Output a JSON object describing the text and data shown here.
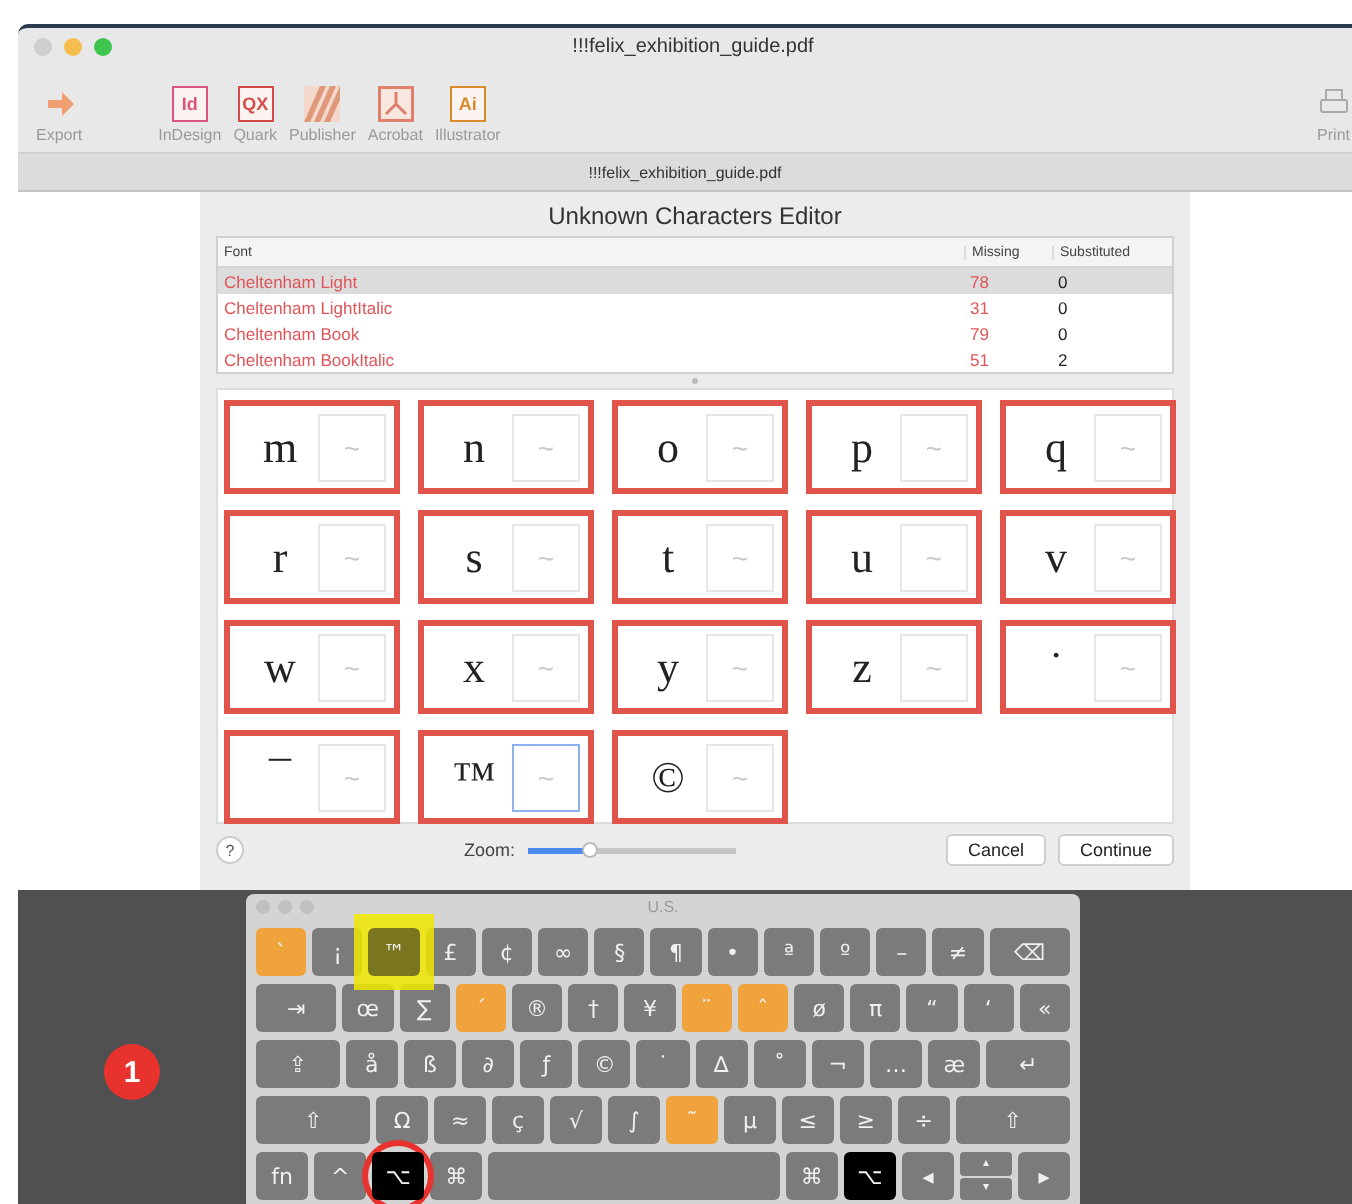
{
  "window": {
    "title": "!!!felix_exhibition_guide.pdf"
  },
  "toolbar": [
    {
      "label": "Export",
      "kind": "export",
      "color": "#f0a070",
      "disabled": true
    },
    {
      "label": "InDesign",
      "kind": "letters",
      "badge": "Id",
      "color": "#d9557f",
      "disabled": true
    },
    {
      "label": "Quark",
      "kind": "letters",
      "badge": "QX",
      "color": "#d64a4a",
      "disabled": true
    },
    {
      "label": "Publisher",
      "kind": "stripes",
      "color": "#e0987a",
      "disabled": true
    },
    {
      "label": "Acrobat",
      "kind": "acrobat",
      "color": "#e07f6b",
      "disabled": true
    },
    {
      "label": "Illustrator",
      "kind": "letters",
      "badge": "Ai",
      "color": "#d98a2a",
      "disabled": true
    }
  ],
  "print": {
    "label": "Print",
    "disabled": true
  },
  "document_tab": {
    "title": "!!!felix_exhibition_guide.pdf"
  },
  "dialog": {
    "title": "Unknown Characters Editor",
    "table": {
      "columns": [
        "Font",
        "Missing",
        "Substituted"
      ],
      "rows": [
        {
          "font": "Cheltenham Light",
          "missing": "78",
          "substituted": "0",
          "selected": true
        },
        {
          "font": "Cheltenham LightItalic",
          "missing": "31",
          "substituted": "0",
          "selected": false
        },
        {
          "font": "Cheltenham Book",
          "missing": "79",
          "substituted": "0",
          "selected": false
        },
        {
          "font": "Cheltenham BookItalic",
          "missing": "51",
          "substituted": "2",
          "selected": false
        }
      ]
    },
    "glyphs": [
      {
        "glyph": "m",
        "placeholder": "~",
        "focused": false
      },
      {
        "glyph": "n",
        "placeholder": "~",
        "focused": false
      },
      {
        "glyph": "o",
        "placeholder": "~",
        "focused": false
      },
      {
        "glyph": "p",
        "placeholder": "~",
        "focused": false
      },
      {
        "glyph": "q",
        "placeholder": "~",
        "focused": false
      },
      {
        "glyph": "r",
        "placeholder": "~",
        "focused": false
      },
      {
        "glyph": "s",
        "placeholder": "~",
        "focused": false
      },
      {
        "glyph": "t",
        "placeholder": "~",
        "focused": false
      },
      {
        "glyph": "u",
        "placeholder": "~",
        "focused": false
      },
      {
        "glyph": "v",
        "placeholder": "~",
        "focused": false
      },
      {
        "glyph": "w",
        "placeholder": "~",
        "focused": false
      },
      {
        "glyph": "x",
        "placeholder": "~",
        "focused": false
      },
      {
        "glyph": "y",
        "placeholder": "~",
        "focused": false
      },
      {
        "glyph": "z",
        "placeholder": "~",
        "focused": false
      },
      {
        "glyph": "˙",
        "placeholder": "~",
        "focused": false
      },
      {
        "glyph": "¯",
        "placeholder": "~",
        "focused": false
      },
      {
        "glyph": "™",
        "placeholder": "~",
        "focused": true
      },
      {
        "glyph": "©",
        "placeholder": "~",
        "focused": false
      }
    ],
    "help": "?",
    "zoom": {
      "label": "Zoom:",
      "level": 0.3
    },
    "buttons": [
      "Cancel",
      "Continue"
    ]
  },
  "annotation_badge": {
    "label": "1"
  },
  "keyboard": {
    "title": "U.S.",
    "rows": [
      [
        {
          "label": "`",
          "kind": "dead"
        },
        {
          "label": "¡",
          "kind": "char"
        },
        {
          "label": "™",
          "kind": "boxed"
        },
        {
          "label": "£",
          "kind": "char"
        },
        {
          "label": "¢",
          "kind": "char"
        },
        {
          "label": "∞",
          "kind": "char"
        },
        {
          "label": "§",
          "kind": "char"
        },
        {
          "label": "¶",
          "kind": "char"
        },
        {
          "label": "•",
          "kind": "char"
        },
        {
          "label": "ª",
          "kind": "char"
        },
        {
          "label": "º",
          "kind": "char"
        },
        {
          "label": "–",
          "kind": "char"
        },
        {
          "label": "≠",
          "kind": "char"
        },
        {
          "label": "⌫",
          "kind": "wide"
        }
      ],
      [
        {
          "label": "⇥",
          "kind": "wide"
        },
        {
          "label": "œ",
          "kind": "char"
        },
        {
          "label": "∑",
          "kind": "char"
        },
        {
          "label": "´",
          "kind": "dead"
        },
        {
          "label": "®",
          "kind": "char"
        },
        {
          "label": "†",
          "kind": "char"
        },
        {
          "label": "¥",
          "kind": "char"
        },
        {
          "label": "¨",
          "kind": "dead"
        },
        {
          "label": "ˆ",
          "kind": "dead"
        },
        {
          "label": "ø",
          "kind": "char"
        },
        {
          "label": "π",
          "kind": "char"
        },
        {
          "label": "“",
          "kind": "char"
        },
        {
          "label": "‘",
          "kind": "char"
        },
        {
          "label": "«",
          "kind": "char"
        }
      ],
      [
        {
          "label": "⇪",
          "kind": "wide"
        },
        {
          "label": "å",
          "kind": "char"
        },
        {
          "label": "ß",
          "kind": "char"
        },
        {
          "label": "∂",
          "kind": "char"
        },
        {
          "label": "ƒ",
          "kind": "char"
        },
        {
          "label": "©",
          "kind": "char"
        },
        {
          "label": "˙",
          "kind": "char"
        },
        {
          "label": "∆",
          "kind": "char"
        },
        {
          "label": "˚",
          "kind": "char"
        },
        {
          "label": "¬",
          "kind": "char"
        },
        {
          "label": "…",
          "kind": "char"
        },
        {
          "label": "æ",
          "kind": "char"
        },
        {
          "label": "↵",
          "kind": "wide"
        }
      ],
      [
        {
          "label": "⇧",
          "kind": "wider"
        },
        {
          "label": "Ω",
          "kind": "char"
        },
        {
          "label": "≈",
          "kind": "char"
        },
        {
          "label": "ç",
          "kind": "char"
        },
        {
          "label": "√",
          "kind": "char"
        },
        {
          "label": "∫",
          "kind": "char"
        },
        {
          "label": "˜",
          "kind": "dead"
        },
        {
          "label": "µ",
          "kind": "char"
        },
        {
          "label": "≤",
          "kind": "char"
        },
        {
          "label": "≥",
          "kind": "char"
        },
        {
          "label": "÷",
          "kind": "char"
        },
        {
          "label": "⇧",
          "kind": "wider"
        }
      ],
      [
        {
          "label": "fn",
          "kind": "char"
        },
        {
          "label": "^",
          "kind": "char"
        },
        {
          "label": "⌥",
          "kind": "circled"
        },
        {
          "label": "⌘",
          "kind": "char"
        },
        {
          "kind": "space"
        },
        {
          "label": "⌘",
          "kind": "char"
        },
        {
          "label": "⌥",
          "kind": "pressed"
        },
        {
          "label": "◂",
          "kind": "char"
        },
        {
          "label": "▴",
          "label2": "▾",
          "kind": "split"
        },
        {
          "label": "▸",
          "kind": "char"
        }
      ]
    ]
  }
}
